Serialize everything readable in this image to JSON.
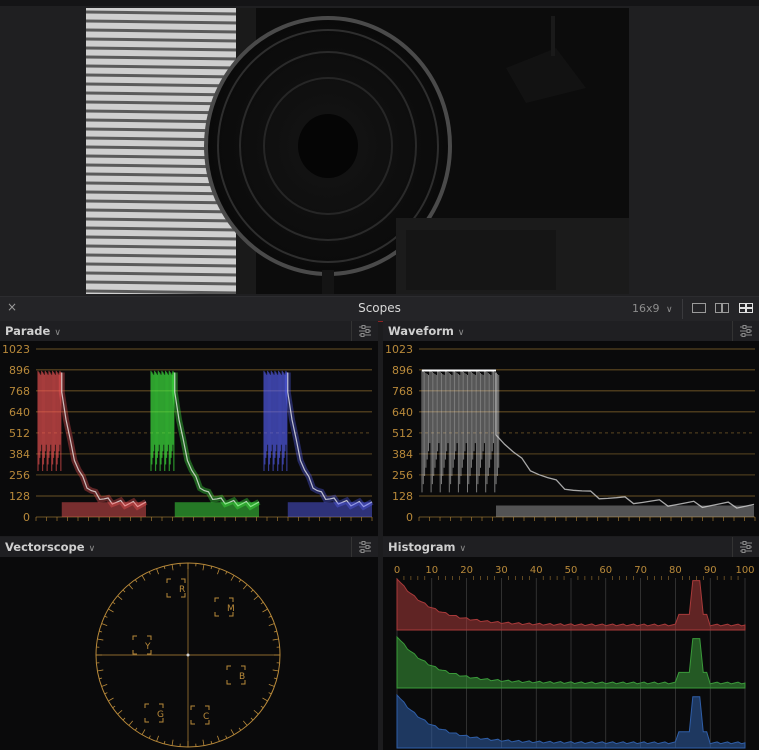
{
  "scopes_bar": {
    "close_label": "×",
    "title": "Scopes",
    "resolution": "16x9"
  },
  "panels": {
    "parade": {
      "title": "Parade",
      "chevron": "∨"
    },
    "waveform": {
      "title": "Waveform",
      "chevron": "∨"
    },
    "vectorscope": {
      "title": "Vectorscope",
      "chevron": "∨"
    },
    "histogram": {
      "title": "Histogram",
      "chevron": "∨"
    }
  },
  "waveform_scale": {
    "ticks": [
      {
        "label": "1023",
        "value": 1023,
        "dashed": false
      },
      {
        "label": "896",
        "value": 896,
        "dashed": false
      },
      {
        "label": "768",
        "value": 768,
        "dashed": false
      },
      {
        "label": "640",
        "value": 640,
        "dashed": false
      },
      {
        "label": "512",
        "value": 512,
        "dashed": true
      },
      {
        "label": "384",
        "value": 384,
        "dashed": false
      },
      {
        "label": "256",
        "value": 256,
        "dashed": false
      },
      {
        "label": "128",
        "value": 128,
        "dashed": false
      },
      {
        "label": "0",
        "value": 0,
        "dashed": false
      }
    ],
    "max": 1023
  },
  "histogram_scale": {
    "ticks": [
      "0",
      "10",
      "20",
      "30",
      "40",
      "50",
      "60",
      "70",
      "80",
      "90",
      "100"
    ]
  },
  "vectorscope_targets": [
    "R",
    "M",
    "B",
    "C",
    "G",
    "Y"
  ],
  "colors": {
    "accent_red": "#8a2222",
    "graticule": "#b8893a",
    "parade_red": "#ff5a5a",
    "parade_green": "#46ff46",
    "parade_blue": "#5a64ff",
    "hist_red": "#a83a3a",
    "hist_green": "#3a9a3a",
    "hist_blue": "#2f5ea8"
  }
}
